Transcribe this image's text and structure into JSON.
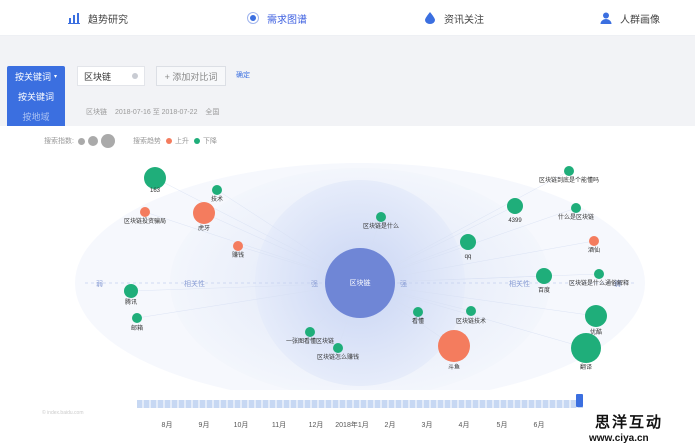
{
  "nav": {
    "tabs": [
      {
        "label": "趋势研究",
        "icon": "bar-chart-icon",
        "active": false
      },
      {
        "label": "需求图谱",
        "icon": "graph-icon",
        "active": true
      },
      {
        "label": "资讯关注",
        "icon": "drop-icon",
        "active": false
      },
      {
        "label": "人群画像",
        "icon": "user-icon",
        "active": false
      }
    ]
  },
  "search": {
    "dropdown_label": "按关键词",
    "menu_items": [
      "按关键词",
      "按地域"
    ],
    "keyword": "区块链",
    "add_compare": "+ 添加对比词",
    "confirm": "确定",
    "meta_keyword": "区块链",
    "meta_range": "2018-07-16 至 2018-07-22",
    "meta_region": "全国"
  },
  "legend": {
    "index_label": "搜索指数:",
    "trend_label": "搜索趋势",
    "up_label": "上升",
    "down_label": "下降",
    "up_color": "#f47c5e",
    "down_color": "#1fae7a"
  },
  "colors": {
    "accent": "#3b6fe0",
    "center": "#6f86d6"
  },
  "chart_data": {
    "type": "scatter",
    "center": {
      "label": "区块链"
    },
    "axis_labels": {
      "strong_left": "强",
      "weak_left": "弱",
      "rel_left": "相关性",
      "rel_right": "相关性",
      "strong_right": "强",
      "weak_right": "弱"
    },
    "bubbles": [
      {
        "label": "163",
        "trend": "down",
        "size": 3
      },
      {
        "label": "技术",
        "trend": "down",
        "size": 1
      },
      {
        "label": "区块链投资骗局",
        "trend": "up",
        "size": 1
      },
      {
        "label": "虎牙",
        "trend": "up",
        "size": 3
      },
      {
        "label": "赚钱",
        "trend": "up",
        "size": 1
      },
      {
        "label": "腾讯",
        "trend": "down",
        "size": 2
      },
      {
        "label": "邮箱",
        "trend": "down",
        "size": 1
      },
      {
        "label": "区块链是什么",
        "trend": "down",
        "size": 1
      },
      {
        "label": "一张图看懂区块链",
        "trend": "down",
        "size": 1
      },
      {
        "label": "区块链怎么赚钱",
        "trend": "down",
        "size": 1
      },
      {
        "label": "看懂",
        "trend": "down",
        "size": 1
      },
      {
        "label": "区块链技术",
        "trend": "down",
        "size": 1
      },
      {
        "label": "斗鱼",
        "trend": "up",
        "size": 4
      },
      {
        "label": "qq",
        "trend": "down",
        "size": 2
      },
      {
        "label": "4399",
        "trend": "down",
        "size": 2
      },
      {
        "label": "区块链到底是个能懂吗",
        "trend": "down",
        "size": 1
      },
      {
        "label": "什么是区块链",
        "trend": "down",
        "size": 1
      },
      {
        "label": "酒仙",
        "trend": "up",
        "size": 1
      },
      {
        "label": "百度",
        "trend": "down",
        "size": 2
      },
      {
        "label": "区块链是什么通俗解释",
        "trend": "down",
        "size": 1
      },
      {
        "label": "优酷",
        "trend": "down",
        "size": 3
      },
      {
        "label": "翻译",
        "trend": "down",
        "size": 4
      }
    ]
  },
  "timeline": {
    "months": [
      "8月",
      "9月",
      "10月",
      "11月",
      "12月",
      "2018年1月",
      "2月",
      "3月",
      "4月",
      "5月",
      "6月"
    ]
  },
  "source": "© index.baidu.com",
  "brand": {
    "name": "思洋互动",
    "url": "www.ciya.cn"
  }
}
